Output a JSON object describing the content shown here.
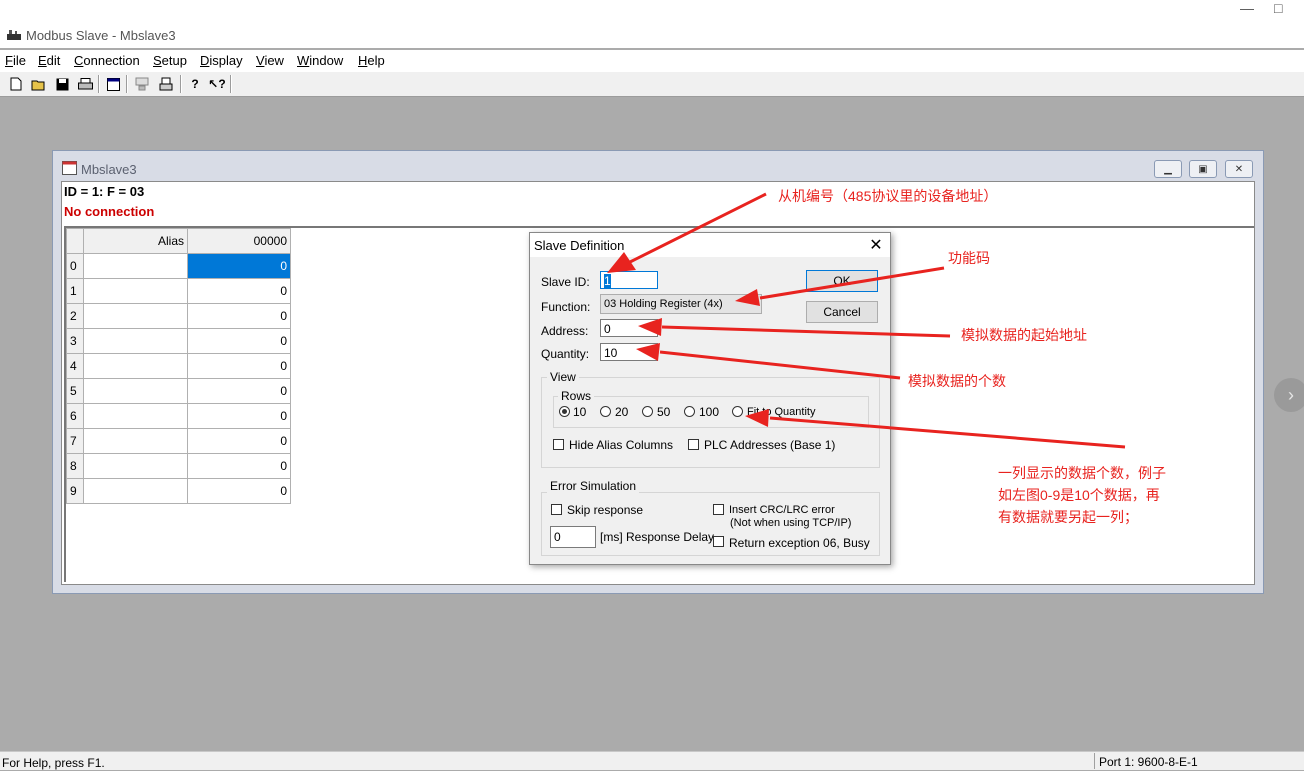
{
  "app": {
    "title": "Modbus Slave - Mbslave3",
    "window_controls": {
      "minimize": "—",
      "restore": "□"
    }
  },
  "menu": [
    {
      "label": "File",
      "ul": "F",
      "rest": "ile"
    },
    {
      "label": "Edit",
      "ul": "E",
      "rest": "dit"
    },
    {
      "label": "Connection",
      "ul": "C",
      "rest": "onnection"
    },
    {
      "label": "Setup",
      "ul": "S",
      "rest": "etup"
    },
    {
      "label": "Display",
      "ul": "D",
      "rest": "isplay"
    },
    {
      "label": "View",
      "ul": "V",
      "rest": "iew"
    },
    {
      "label": "Window",
      "ul": "W",
      "rest": "indow"
    },
    {
      "label": "Help",
      "ul": "H",
      "rest": "elp"
    }
  ],
  "toolbar": {
    "icons": [
      "new-icon",
      "open-icon",
      "save-icon",
      "print-icon",
      "window-icon",
      "connect-icon",
      "print-preview-icon",
      "help-icon",
      "context-help-icon"
    ]
  },
  "mdi": {
    "title": "Mbslave3",
    "info_id": "ID = 1: F = 03",
    "info_connection": "No connection",
    "grid": {
      "headers": [
        "Alias",
        "00000"
      ],
      "rows": [
        {
          "index": "0",
          "alias": "",
          "value": "0"
        },
        {
          "index": "1",
          "alias": "",
          "value": "0"
        },
        {
          "index": "2",
          "alias": "",
          "value": "0"
        },
        {
          "index": "3",
          "alias": "",
          "value": "0"
        },
        {
          "index": "4",
          "alias": "",
          "value": "0"
        },
        {
          "index": "5",
          "alias": "",
          "value": "0"
        },
        {
          "index": "6",
          "alias": "",
          "value": "0"
        },
        {
          "index": "7",
          "alias": "",
          "value": "0"
        },
        {
          "index": "8",
          "alias": "",
          "value": "0"
        },
        {
          "index": "9",
          "alias": "",
          "value": "0"
        }
      ]
    }
  },
  "dialog": {
    "title": "Slave Definition",
    "close": "✕",
    "slave_id_label": "Slave ID:",
    "slave_id_value": "1",
    "function_label": "Function:",
    "function_value": "03 Holding Register (4x)",
    "address_label": "Address:",
    "address_value": "0",
    "quantity_label": "Quantity:",
    "quantity_value": "10",
    "ok": "OK",
    "cancel": "Cancel",
    "view_group": "View",
    "rows_group": "Rows",
    "rows_options": [
      "10",
      "20",
      "50",
      "100",
      "Fit to Quantity"
    ],
    "rows_selected": "10",
    "hide_alias": "Hide Alias Columns",
    "plc_addresses": "PLC Addresses (Base 1)",
    "error_group": "Error Simulation",
    "skip_response": "Skip response",
    "insert_crc": "Insert CRC/LRC error",
    "insert_crc_note": "(Not when using TCP/IP)",
    "response_delay_value": "0",
    "response_delay_label": "[ms] Response Delay",
    "return_exception": "Return exception 06, Busy"
  },
  "annotations": {
    "slave_id": "从机编号（485协议里的设备地址）",
    "function": "功能码",
    "address": "模拟数据的起始地址",
    "quantity": "模拟数据的个数",
    "rows_line1": "一列显示的数据个数，例子",
    "rows_line2": "如左图0-9是10个数据，再",
    "rows_line3": "有数据就要另起一列；",
    "color": "#e8231f"
  },
  "statusbar": {
    "help": "For Help, press F1.",
    "port": "Port 1: 9600-8-E-1"
  }
}
